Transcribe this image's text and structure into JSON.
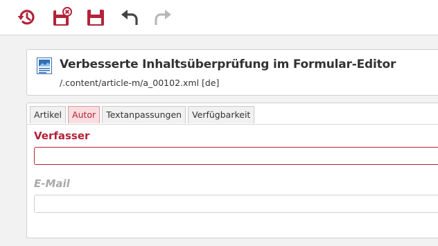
{
  "toolbar": {
    "buttons": [
      {
        "name": "history",
        "icon": "history-icon"
      },
      {
        "name": "save-and-exit",
        "icon": "save-close-icon"
      },
      {
        "name": "save",
        "icon": "save-icon"
      },
      {
        "name": "undo",
        "icon": "undo-icon"
      },
      {
        "name": "redo",
        "icon": "redo-icon"
      }
    ],
    "accent_color": "#b3233a",
    "undo_color": "#444444",
    "redo_color": "#b8b8b8"
  },
  "document": {
    "title": "Verbesserte Inhaltsüberprüfung im Formular-Editor",
    "path": "/.content/article-m/a_00102.xml [de]"
  },
  "tabs": [
    {
      "label": "Artikel",
      "active": false
    },
    {
      "label": "Autor",
      "active": true
    },
    {
      "label": "Textanpassungen",
      "active": false
    },
    {
      "label": "Verfügbarkeit",
      "active": false
    }
  ],
  "fields": {
    "author": {
      "label": "Verfasser",
      "value": ""
    },
    "email": {
      "label": "E-Mail",
      "value": ""
    }
  }
}
